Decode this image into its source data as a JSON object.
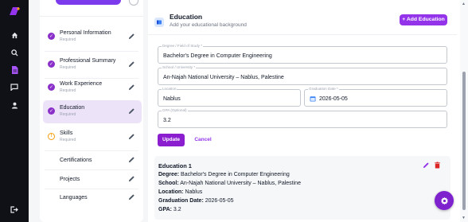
{
  "rail": {
    "icons": [
      "logo-icon",
      "home-icon",
      "search-icon",
      "document-icon",
      "chat-icon",
      "user-icon",
      "logout-icon"
    ],
    "active": "document-icon",
    "accent": "#a855f7"
  },
  "sidebar": {
    "items": [
      {
        "label": "Personal Information",
        "sub": "Required",
        "status": "done"
      },
      {
        "label": "Professional Summary",
        "sub": "Required",
        "status": "done"
      },
      {
        "label": "Work Experience",
        "sub": "Required",
        "status": "done"
      },
      {
        "label": "Education",
        "sub": "Required",
        "status": "done",
        "active": true
      },
      {
        "label": "Skills",
        "sub": "Required",
        "status": "warning"
      },
      {
        "label": "Certifications",
        "sub": "",
        "status": "none"
      },
      {
        "label": "Projects",
        "sub": "",
        "status": "none"
      },
      {
        "label": "Languages",
        "sub": "",
        "status": "none"
      }
    ]
  },
  "section": {
    "title": "Education",
    "subtitle": "Add your educational background",
    "add_label": "Add Education"
  },
  "form": {
    "degree": {
      "label": "Degree / Field of Study *",
      "value": "Bachelor's Degree in Computer Engineering"
    },
    "school": {
      "label": "School / University *",
      "value": "An-Najah National University – Nablus, Palestine"
    },
    "location": {
      "label": "Location",
      "value": "Nablus"
    },
    "graduation": {
      "label": "Graduation Date *",
      "value": "2026-05-05"
    },
    "gpa": {
      "label": "GPA (Optional)",
      "value": "3.2"
    },
    "update_label": "Update",
    "cancel_label": "Cancel"
  },
  "entry": {
    "title": "Education 1",
    "degree_label": "Degree:",
    "degree_value": " Bachelor's Degree in Computer Engineering",
    "school_label": "School:",
    "school_value": " An-Najah National University – Nablus, Palestine",
    "location_label": "Location:",
    "location_value": " Nablus",
    "grad_label": "Graduation Date:",
    "grad_value": " 2026-05-05",
    "gpa_label": "GPA:",
    "gpa_value": " 3.2"
  },
  "colors": {
    "primary": "#9333ea",
    "check": "#8b2fc9",
    "warning": "#f59e0b",
    "delete": "#dc2626"
  }
}
